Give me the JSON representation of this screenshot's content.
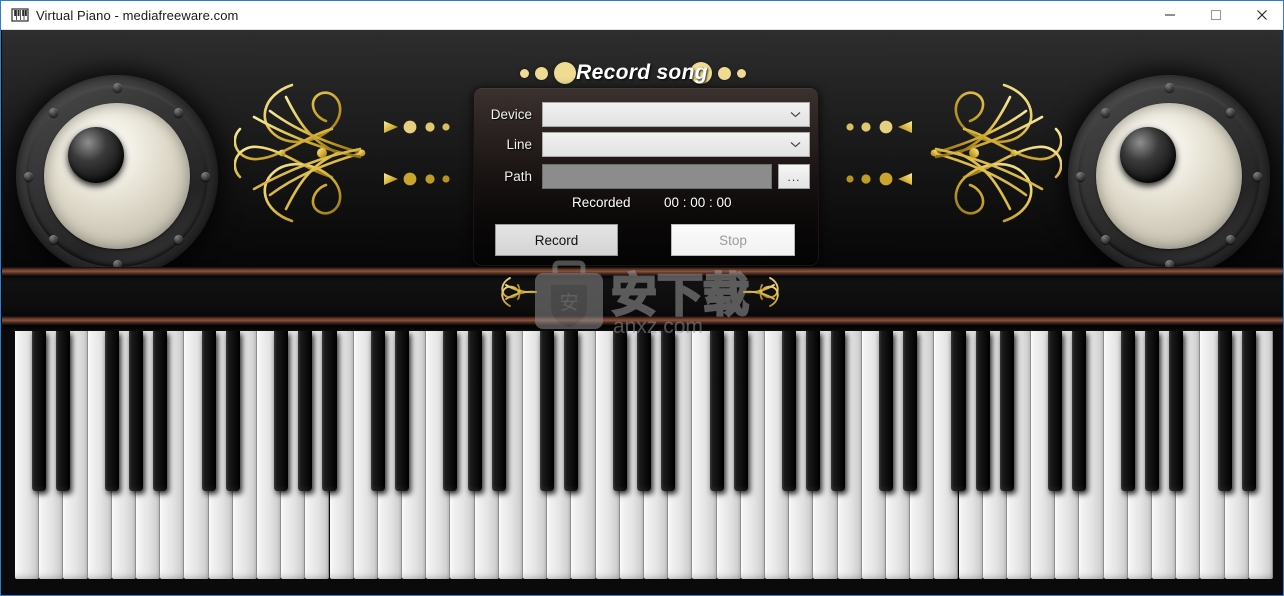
{
  "window": {
    "title": "Virtual Piano - mediafreeware.com",
    "icon": "piano-keys-icon",
    "controls": {
      "minimize": "minimize-icon",
      "maximize": "maximize-icon",
      "close": "close-icon"
    }
  },
  "record_panel": {
    "heading": "Record song",
    "fields": {
      "device_label": "Device",
      "device_value": "",
      "line_label": "Line",
      "line_value": "",
      "path_label": "Path",
      "path_value": "",
      "browse_label": "..."
    },
    "status": {
      "recorded_label": "Recorded",
      "recorded_time": "00 : 00 : 00"
    },
    "buttons": {
      "record_label": "Record",
      "record_enabled": true,
      "stop_label": "Stop",
      "stop_enabled": false
    }
  },
  "decor": {
    "speaker_left": "speaker-icon",
    "speaker_right": "speaker-icon",
    "ornament_left": "gold-filigree-ornament",
    "ornament_right": "gold-filigree-ornament",
    "dot_color": "#efdb92"
  },
  "watermark": {
    "chinese_text": "安下载",
    "site_text": "anxz.com",
    "badge_text": "安"
  },
  "keyboard": {
    "white_key_count": 52,
    "octave_pattern": "CDEFGAB",
    "black_key_pattern": "C#,D#,F#,G#,A#"
  },
  "colors": {
    "background_top": "#2e2e2e",
    "background_bottom": "#070707",
    "accent_gold": "#d4af37",
    "panel_dark": "#2c2422",
    "wood_strip": "#8a5440",
    "title_text": "#ffffff",
    "window_border": "#2a7fd4"
  }
}
